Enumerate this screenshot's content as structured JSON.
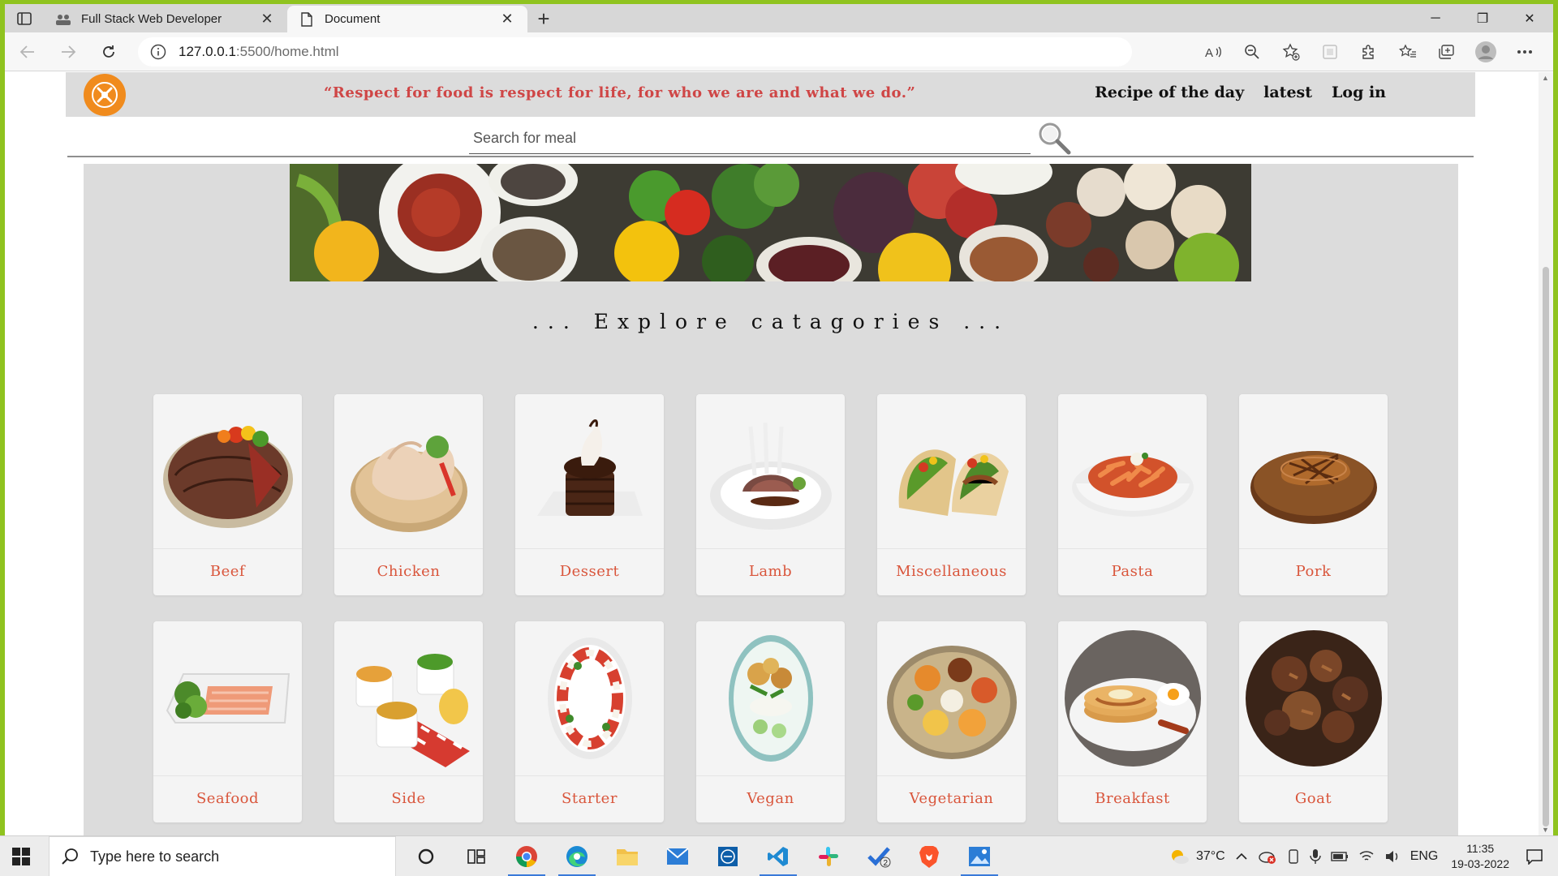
{
  "browser": {
    "tabs": [
      {
        "title": "Full Stack Web Developer",
        "active": false
      },
      {
        "title": "Document",
        "active": true
      }
    ],
    "url_host": "127.0.0.1",
    "url_rest": ":5500/home.html"
  },
  "site": {
    "quote": "“Respect for food is respect for life, for who we are and what we do.”",
    "nav": [
      "Recipe of the day",
      "latest",
      "Log in"
    ],
    "search_placeholder": "Search for meal",
    "explore_heading": "... Explore catagories ..."
  },
  "categories": [
    {
      "name": "Beef",
      "icon": "steak-icon",
      "accent": "#6b3a2a"
    },
    {
      "name": "Chicken",
      "icon": "chicken-icon",
      "accent": "#e9c9a8"
    },
    {
      "name": "Dessert",
      "icon": "cake-icon",
      "accent": "#4a2616"
    },
    {
      "name": "Lamb",
      "icon": "lamb-chop-icon",
      "accent": "#7a4a42"
    },
    {
      "name": "Miscellaneous",
      "icon": "taco-icon",
      "accent": "#e2c58a"
    },
    {
      "name": "Pasta",
      "icon": "pasta-icon",
      "accent": "#d2522b"
    },
    {
      "name": "Pork",
      "icon": "pork-icon",
      "accent": "#8a5326"
    },
    {
      "name": "Seafood",
      "icon": "salmon-icon",
      "accent": "#ef9a78"
    },
    {
      "name": "Side",
      "icon": "side-bowls-icon",
      "accent": "#e6a13a"
    },
    {
      "name": "Starter",
      "icon": "caprese-icon",
      "accent": "#d7402f"
    },
    {
      "name": "Vegan",
      "icon": "vegan-plate-icon",
      "accent": "#8db06a"
    },
    {
      "name": "Vegetarian",
      "icon": "thali-icon",
      "accent": "#e68a2c"
    },
    {
      "name": "Breakfast",
      "icon": "pancakes-icon",
      "accent": "#c98a3e"
    },
    {
      "name": "Goat",
      "icon": "goat-meat-icon",
      "accent": "#5a3220"
    }
  ],
  "taskbar": {
    "search_placeholder": "Type here to search",
    "weather": "37°C",
    "language": "ENG",
    "time": "11:35",
    "date": "19-03-2022",
    "badge_count": "2"
  },
  "colors": {
    "accent_label": "#d9553b",
    "quote": "#cf4646",
    "logo": "#f08b1d",
    "header_bg": "#dcdcdc"
  }
}
